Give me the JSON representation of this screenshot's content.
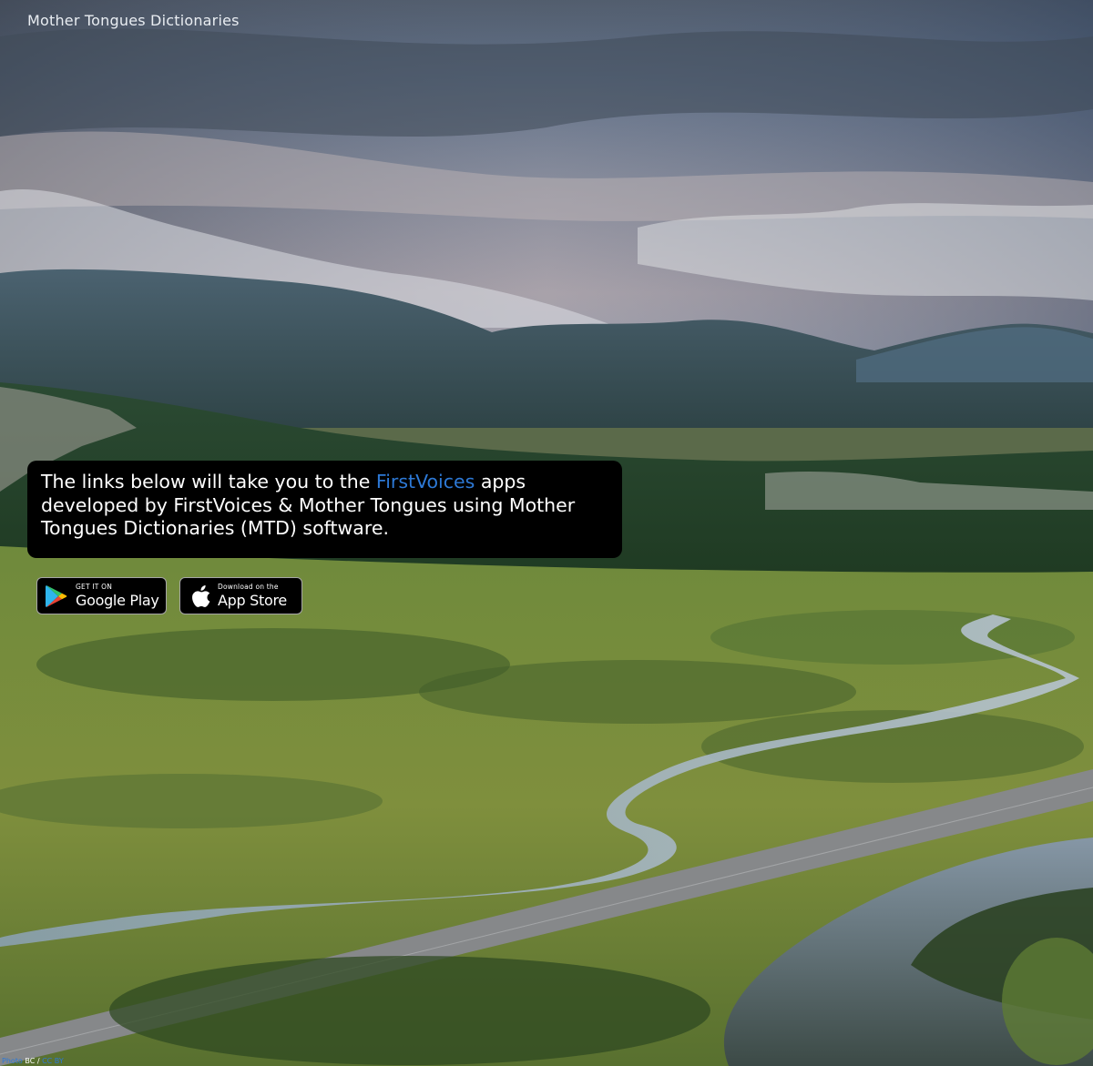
{
  "header": {
    "site_title": "Mother Tongues Dictionaries"
  },
  "intro": {
    "text_before": "The links below will take you to the ",
    "link_text": "FirstVoices",
    "text_after": " apps developed by FirstVoices & Mother Tongues using Mother Tongues Dictionaries (MTD) software."
  },
  "store_badges": {
    "google_play": {
      "small_text": "GET IT ON",
      "big_text": "Google Play",
      "icon": "google-play-icon"
    },
    "app_store": {
      "small_text": "Download on the",
      "big_text": "App Store",
      "icon": "apple-icon"
    }
  },
  "photo_credit": {
    "prefix": "Photo",
    "owner": "BC",
    "separator": " / ",
    "license": "CC BY"
  },
  "colors": {
    "link": "#2d79d6",
    "box_background": "#000000",
    "title_text": "#e9edf2"
  }
}
